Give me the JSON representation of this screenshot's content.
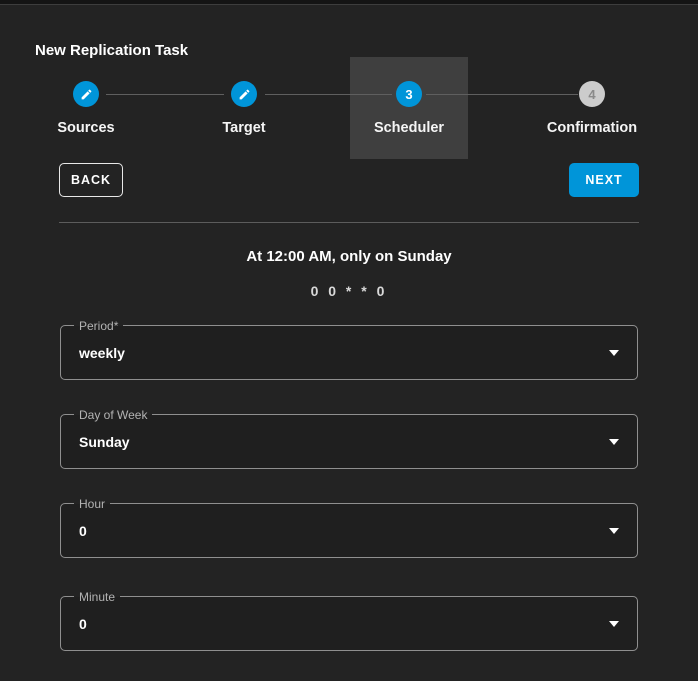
{
  "window": {
    "title": "New Replication Task"
  },
  "stepper": {
    "steps": [
      {
        "label": "Sources",
        "state": "completed-editable",
        "icon": "pencil-icon"
      },
      {
        "label": "Target",
        "state": "completed-editable",
        "icon": "pencil-icon"
      },
      {
        "label": "Scheduler",
        "state": "active",
        "number": "3"
      },
      {
        "label": "Confirmation",
        "state": "pending",
        "number": "4"
      }
    ]
  },
  "actions": {
    "back_label": "BACK",
    "next_label": "NEXT"
  },
  "schedule": {
    "summary": "At 12:00 AM, only on Sunday",
    "cron_expression": "0 0 * * 0"
  },
  "form": {
    "fields": [
      {
        "label": "Period*",
        "value": "weekly"
      },
      {
        "label": "Day of Week",
        "value": "Sunday"
      },
      {
        "label": "Hour",
        "value": "0"
      },
      {
        "label": "Minute",
        "value": "0"
      }
    ]
  },
  "colors": {
    "accent_blue": "#0095d9",
    "pending_step_gray": "#cccccc",
    "background": "#232323",
    "step_highlight": "#3f3f3f"
  }
}
